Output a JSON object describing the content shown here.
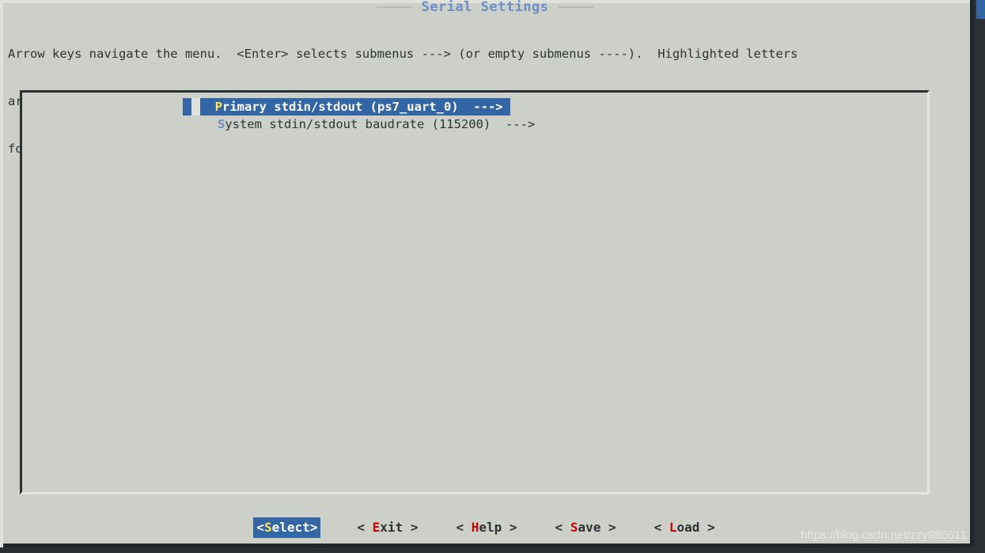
{
  "window": {
    "title": "Serial Settings"
  },
  "help": {
    "lines": [
      "Arrow keys navigate the menu.  <Enter> selects submenus ---> (or empty submenus ----).  Highlighted letters",
      "are hotkeys.  Pressing <Y> includes, <N> excludes, <M> modularizes features.  Press <Esc><Esc> to exit, <?>",
      "for Help, </> for Search.  Legend: [*] built-in  [ ] excluded  <M> module  < > module capable"
    ]
  },
  "menu": {
    "items": [
      {
        "hotkey": "P",
        "rest": "rimary stdin/stdout (ps7_uart_0)  --->",
        "full_label": "Primary stdin/stdout (ps7_uart_0)  --->",
        "selected": true
      },
      {
        "hotkey": "S",
        "rest": "ystem stdin/stdout baudrate (115200)  --->",
        "full_label": "System stdin/stdout baudrate (115200)  --->",
        "selected": false
      }
    ]
  },
  "buttons": [
    {
      "prefix": "<",
      "hotkey": "S",
      "rest": "elect",
      "suffix": ">",
      "active": true
    },
    {
      "prefix": "< ",
      "hotkey": "E",
      "rest": "xit",
      "suffix": " >",
      "active": false
    },
    {
      "prefix": "< ",
      "hotkey": "H",
      "rest": "elp",
      "suffix": " >",
      "active": false
    },
    {
      "prefix": "< ",
      "hotkey": "S",
      "rest": "ave",
      "suffix": " >",
      "active": false
    },
    {
      "prefix": "< ",
      "hotkey": "L",
      "rest": "oad",
      "suffix": " >",
      "active": false
    }
  ],
  "watermark": {
    "text": "https://blog.csdn.net/zzy980511"
  },
  "colors": {
    "background": "#ccd0c8",
    "text": "#2e3436",
    "highlight_bg": "#3465a4",
    "highlight_fg": "#ffffff",
    "hotkey_selected": "#fce94f",
    "hotkey_normal": "#6d8fc7",
    "hotkey_button": "#cc0000",
    "title": "#6d8fc7",
    "border_dark": "#2b3133",
    "border_light": "#e4e7df"
  }
}
